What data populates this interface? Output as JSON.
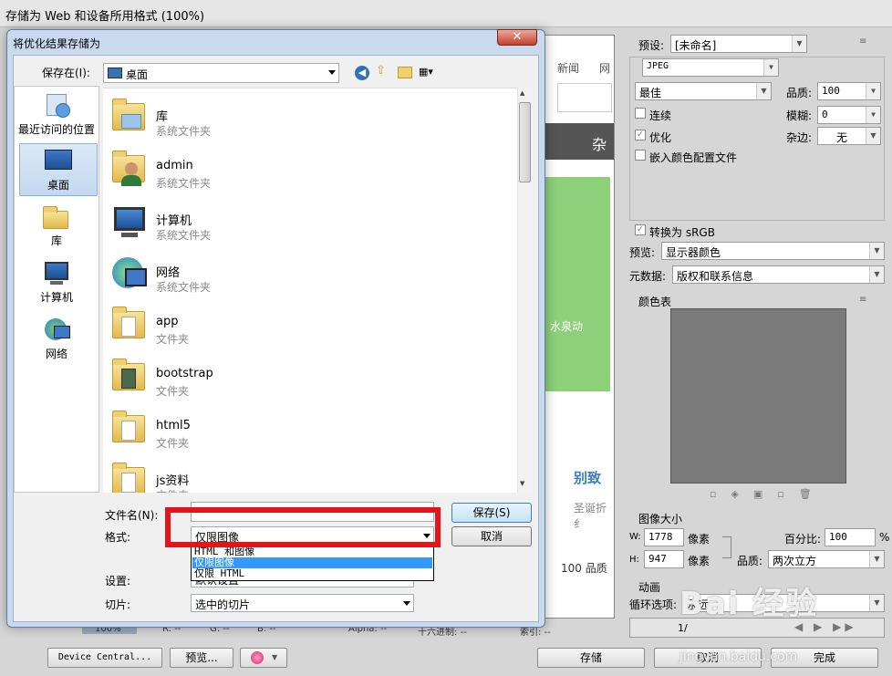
{
  "window": {
    "title": "存储为 Web 和设备所用格式 (100%)"
  },
  "preview": {
    "nav_news": "新闻",
    "nav_more": "网",
    "tab_more": "杂",
    "text1": "水泉动",
    "text2": "别致",
    "text3": "圣诞折纟",
    "quality": "100 品质"
  },
  "right_panel": {
    "preset_label": "预设:",
    "preset_value": "[未命名]",
    "format_value": "JPEG",
    "quality_level": "最佳",
    "quality_label": "品质:",
    "quality_value": "100",
    "progressive_label": "连续",
    "blur_label": "模糊:",
    "blur_value": "0",
    "optimized_label": "优化",
    "matte_label": "杂边:",
    "matte_value": "无",
    "embed_profile_label": "嵌入颜色配置文件",
    "convert_srgb_label": "转换为 sRGB",
    "preview_label": "预览:",
    "preview_value": "显示器颜色",
    "metadata_label": "元数据:",
    "metadata_value": "版权和联系信息",
    "color_table_label": "颜色表",
    "image_size_label": "图像大小",
    "width_label": "W:",
    "width_value": "1778",
    "height_label": "H:",
    "height_value": "947",
    "unit_pixels": "像素",
    "percent_label": "百分比:",
    "percent_value": "100",
    "percent_unit": "%",
    "resample_label": "品质:",
    "resample_value": "两次立方",
    "animation_label": "动画",
    "loop_label": "循环选项:",
    "loop_value": "永远",
    "frame_counter": "1/"
  },
  "bottom_bar": {
    "device_central": "Device Central...",
    "preview_btn": "预览...",
    "save": "存储",
    "cancel": "取消",
    "done": "完成"
  },
  "status_bar": {
    "zoom": "100%",
    "r": "R: --",
    "g": "G: --",
    "b": "B: --",
    "alpha": "Alpha: --",
    "hex": "十六进制: --",
    "index": "索引: --"
  },
  "dialog": {
    "title": "将优化结果存储为",
    "save_in_label": "保存在(I):",
    "save_in_value": "桌面",
    "sidebar": [
      {
        "label": "最近访问的位置",
        "icon": "recent-places-icon"
      },
      {
        "label": "桌面",
        "icon": "desktop-icon"
      },
      {
        "label": "库",
        "icon": "libraries-icon"
      },
      {
        "label": "计算机",
        "icon": "computer-icon"
      },
      {
        "label": "网络",
        "icon": "network-icon"
      }
    ],
    "files": [
      {
        "name": "库",
        "type": "系统文件夹",
        "icon": "libraries-icon"
      },
      {
        "name": "admin",
        "type": "系统文件夹",
        "icon": "user-folder-icon"
      },
      {
        "name": "计算机",
        "type": "系统文件夹",
        "icon": "computer-icon"
      },
      {
        "name": "网络",
        "type": "系统文件夹",
        "icon": "network-icon"
      },
      {
        "name": "app",
        "type": "文件夹",
        "icon": "folder-icon"
      },
      {
        "name": "bootstrap",
        "type": "文件夹",
        "icon": "folder-icon"
      },
      {
        "name": "html5",
        "type": "文件夹",
        "icon": "folder-icon"
      },
      {
        "name": "js资料",
        "type": "文件夹",
        "icon": "folder-icon"
      }
    ],
    "filename_label": "文件名(N):",
    "filename_value": "",
    "format_label": "格式:",
    "format_value": "仅限图像",
    "format_options": [
      "HTML 和图像",
      "仅限图像",
      "仅限 HTML"
    ],
    "settings_label": "设置:",
    "settings_value": "默认设置",
    "slices_label": "切片:",
    "slices_value": "选中的切片",
    "save_button": "保存(S)",
    "cancel_button": "取消"
  },
  "watermark": {
    "brand": "Bai 经验",
    "url": "jingyan.baidu.com"
  },
  "colors": {
    "highlight": "#3399ff",
    "annotation": "#e5141a",
    "dialog_frame": "#c9d9ee"
  }
}
